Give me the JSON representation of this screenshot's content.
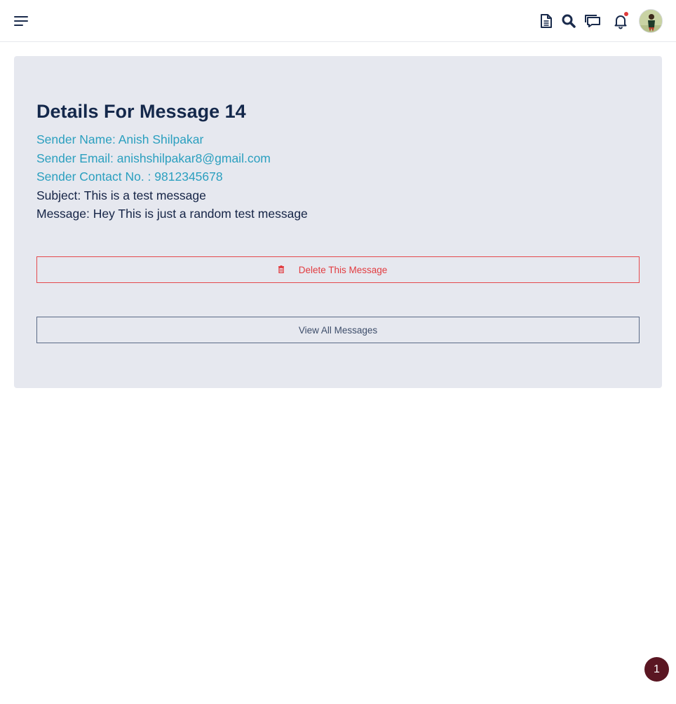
{
  "header": {
    "menu_icon": "hamburger-menu-icon",
    "icons": [
      "document-icon",
      "search-icon",
      "chat-icon",
      "bell-icon"
    ],
    "notification_dot_color": "#e03a3a",
    "avatar": "user-avatar"
  },
  "message": {
    "title": "Details For Message 14",
    "sender_name": "Sender Name: Anish Shilpakar",
    "sender_email": "Sender Email: anishshilpakar8@gmail.com",
    "sender_contact": "Sender Contact No. : 9812345678",
    "subject": "Subject: This is a test message",
    "body": "Message: Hey This is just a random test message"
  },
  "actions": {
    "delete_label": "Delete This Message",
    "delete_icon": "trash-icon",
    "view_all_label": "View All Messages"
  },
  "floating_badge": {
    "value": "1"
  },
  "colors": {
    "title": "#14284b",
    "sender_info": "#2a9fbf",
    "danger": "#e23c40",
    "card_background": "#e6e8ef",
    "badge": "#5a1622"
  }
}
